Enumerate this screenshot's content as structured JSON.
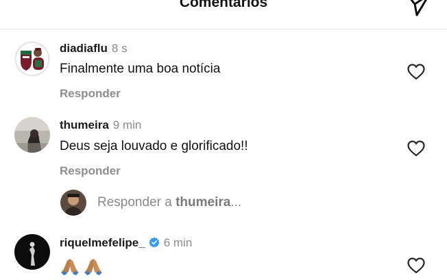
{
  "header": {
    "title": "Comentários",
    "share_icon": "paper-plane-icon"
  },
  "comments": [
    {
      "username": "diadiaflu",
      "time": "8 s",
      "text": "Finalmente uma boa notícia",
      "reply_label": "Responder",
      "like_icon": "heart-outline-icon"
    },
    {
      "username": "thumeira",
      "time": "9 min",
      "text": "Deus seja louvado e glorificado!!",
      "reply_label": "Responder",
      "like_icon": "heart-outline-icon"
    },
    {
      "username": "riquelmefelipe_",
      "time": "6 min",
      "verified": true,
      "text": "🙏🏽🙏🏽",
      "like_icon": "heart-outline-icon"
    }
  ],
  "reply_input": {
    "prefix": "Responder a",
    "target": "thumeira",
    "suffix": "..."
  },
  "colors": {
    "text": "#111111",
    "muted": "#8e8e8e",
    "verified": "#3897f0",
    "divider": "#e6e6e6"
  }
}
